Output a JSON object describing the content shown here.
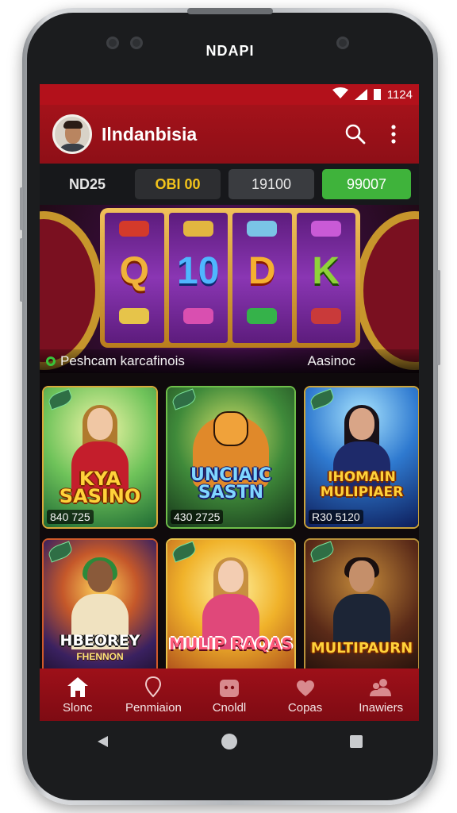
{
  "device": {
    "brand": "NDAPI"
  },
  "status_bar": {
    "time": "1124"
  },
  "app_bar": {
    "title": "Ilndanbisia",
    "search_icon": "search-icon",
    "menu_icon": "more-vert-icon"
  },
  "tabs": [
    {
      "label": "ND25",
      "style": "plain"
    },
    {
      "label": "OBI 00",
      "style": "gold"
    },
    {
      "label": "19100",
      "style": "grey"
    },
    {
      "label": "99007",
      "style": "green"
    }
  ],
  "banner": {
    "symbols": [
      "Q",
      "10",
      "D",
      "K"
    ],
    "caption_left": "Peshcam karcafinois",
    "caption_right": "Aasinoc"
  },
  "games": [
    {
      "title": "KYA SASINO",
      "count": "840 725"
    },
    {
      "title": "UNCIAIC SASTN",
      "count": "430 2725"
    },
    {
      "title": "IHOMAIN MULIPIAER",
      "count": "R30 5120"
    },
    {
      "title": "HBEOREY",
      "subtitle": "FHENNON",
      "count": ""
    },
    {
      "title": "MULIP RAQAS",
      "count": ""
    },
    {
      "title": "MULTIPAURN",
      "count": ""
    }
  ],
  "bottom_nav": [
    {
      "label": "Slonc",
      "icon": "home-icon"
    },
    {
      "label": "Penmiaion",
      "icon": "location-pin-icon"
    },
    {
      "label": "Cnoldl",
      "icon": "controller-icon"
    },
    {
      "label": "Copas",
      "icon": "heart-icon"
    },
    {
      "label": "Inawiers",
      "icon": "users-icon"
    }
  ],
  "colors": {
    "primary_red": "#a4121a",
    "accent_gold": "#f3c31b",
    "accent_green": "#3fb33b"
  }
}
